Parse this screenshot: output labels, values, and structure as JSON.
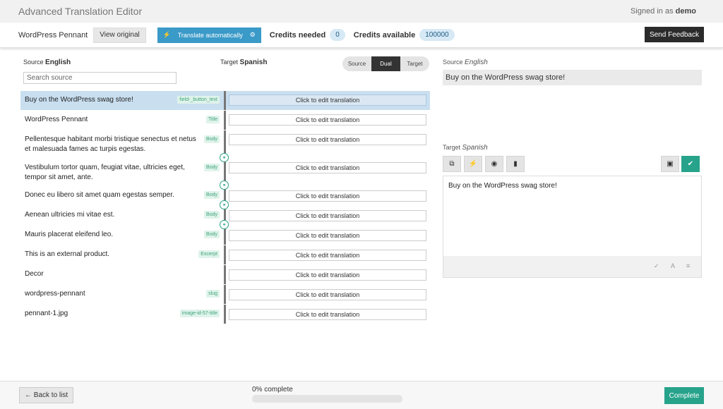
{
  "header": {
    "app_title": "Advanced Translation Editor",
    "signed_in_prefix": "Signed in as",
    "user": "demo"
  },
  "toolbar": {
    "project": "WordPress Pennant",
    "view_original": "View original",
    "translate_auto": "Translate automatically",
    "credits_needed_label": "Credits needed",
    "credits_needed": "0",
    "credits_available_label": "Credits available",
    "credits_available": "100000",
    "feedback": "Send Feedback"
  },
  "list": {
    "source_label": "Source",
    "source_lang": "English",
    "target_label": "Target",
    "target_lang": "Spanish",
    "search_placeholder": "Search source",
    "view_modes": [
      "Source",
      "Dual",
      "Target"
    ],
    "active_mode": "Dual",
    "edit_placeholder": "Click to edit translation",
    "rows": [
      {
        "text": "Buy on the WordPress swag store!",
        "tag": "field-_button_text",
        "selected": true
      },
      {
        "text": "WordPress Pennant",
        "tag": "Title"
      },
      {
        "text": "Pellentesque habitant morbi tristique senectus et netus et malesuada fames ac turpis egestas.",
        "tag": "Body"
      },
      {
        "text": "Vestibulum tortor quam, feugiat vitae, ultricies eget, tempor sit amet, ante.",
        "tag": "Body"
      },
      {
        "text": "Donec eu libero sit amet quam egestas semper.",
        "tag": "Body"
      },
      {
        "text": "Aenean ultricies mi vitae est.",
        "tag": "Body"
      },
      {
        "text": "Mauris placerat eleifend leo.",
        "tag": "Body"
      },
      {
        "text": "This is an external product.",
        "tag": "Excerpt"
      },
      {
        "text": "Decor",
        "tag": ""
      },
      {
        "text": "wordpress-pennant",
        "tag": "slug"
      },
      {
        "text": "pennant-1.jpg",
        "tag": "image-id-57-title"
      }
    ]
  },
  "panel": {
    "source_label": "Source",
    "source_lang": "English",
    "source_text": "Buy on the WordPress swag store!",
    "target_label": "Target",
    "target_lang": "Spanish",
    "target_text": "Buy on the WordPress swag store!",
    "icons": [
      "copy-icon",
      "lightning-icon",
      "hide-icon",
      "book-icon",
      "save-icon",
      "check-icon"
    ]
  },
  "footer": {
    "back": "← Back to list",
    "progress_label": "0% complete",
    "progress": 0,
    "complete": "Complete"
  },
  "colors": {
    "accent": "#27a38b",
    "auto_translate": "#3a9ac8",
    "selected_row": "#c9dff0"
  }
}
